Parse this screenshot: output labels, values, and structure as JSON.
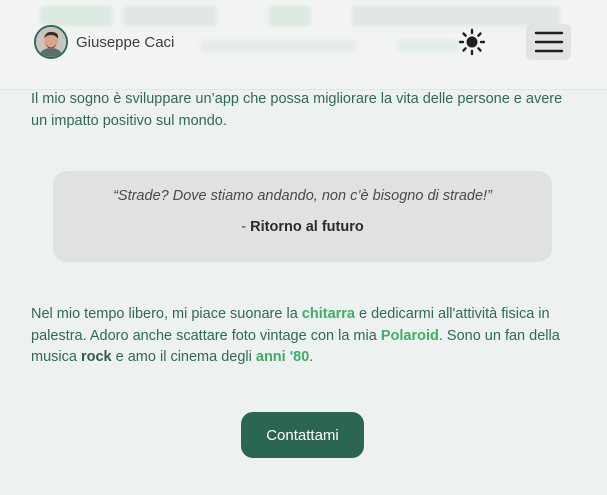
{
  "header": {
    "brand_name": "Giuseppe Caci",
    "theme_icon": "sun-icon",
    "menu_icon": "hamburger-menu-icon"
  },
  "content": {
    "intro": "Il mio sogno è sviluppare un’app che possa migliorare la vita delle persone e avere un impatto positivo sul mondo.",
    "quote": {
      "text": "“Strade? Dove stiamo andando, non c’è bisogno di strade!”",
      "prefix": "- ",
      "source": "Ritorno al futuro"
    },
    "hobbies": {
      "t1": "Nel mio tempo libero, mi piace suonare la ",
      "h1": "chitarra",
      "t2": " e dedicarmi all'attività fisica in palestra. Adoro anche scattare foto vintage con la mia ",
      "h2": "Polaroid",
      "t3": ". Sono un fan della musica ",
      "h3": "rock",
      "t4": " e amo il cinema degli ",
      "h4": "anni '80",
      "t5": "."
    },
    "cta_label": "Contattami"
  },
  "colors": {
    "background": "#edf1f0",
    "text": "#2f6b52",
    "highlight": "#3fae68",
    "button": "#2b6650",
    "quote_bg": "#e0e1e1"
  }
}
